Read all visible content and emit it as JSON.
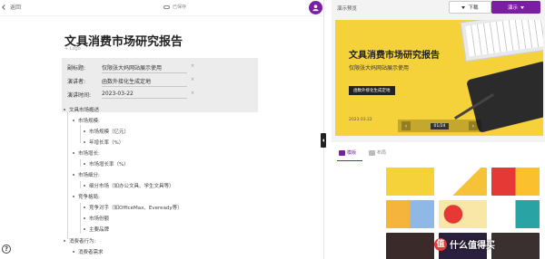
{
  "topbar": {
    "back_label": "返回",
    "saved_label": "已保存"
  },
  "doc": {
    "title": "文具消费市场研究报告",
    "logo_placeholder": "+ Logo",
    "meta": [
      {
        "key": "副标题:",
        "value": "仅限张大妈网站展示使用"
      },
      {
        "key": "演讲者:",
        "value": "函数外接化生成定地"
      },
      {
        "key": "演讲时间:",
        "value": "2023-03-22"
      }
    ],
    "outline": [
      {
        "level": 0,
        "text": "文具市场概述"
      },
      {
        "level": 1,
        "text": "市场规模:"
      },
      {
        "level": 2,
        "text": "市场规模（亿元）"
      },
      {
        "level": 2,
        "text": "年增长率（%）"
      },
      {
        "level": 1,
        "text": "市场增长:"
      },
      {
        "level": 2,
        "text": "市场增长率（%）"
      },
      {
        "level": 1,
        "text": "市场细分:"
      },
      {
        "level": 2,
        "text": "细分市场（如办公文具、学生文具等）"
      },
      {
        "level": 1,
        "text": "竞争格局:"
      },
      {
        "level": 2,
        "text": "竞争对手（如OfficeMax、Eveready等）"
      },
      {
        "level": 2,
        "text": "市场份额"
      },
      {
        "level": 2,
        "text": "主要品牌"
      },
      {
        "level": 0,
        "text": "消费者行为:"
      },
      {
        "level": 1,
        "text": "消费者需求"
      }
    ]
  },
  "preview": {
    "title": "演示预览",
    "download_label": "下载",
    "play_label": "演示",
    "slide": {
      "title": "文具消费市场研究报告",
      "subtitle": "仅限张大妈网站展示使用",
      "tag": "函数外接化生成定地",
      "date": "2023.03.22",
      "counter": "01/24"
    },
    "tabs": [
      {
        "label": "模版",
        "active": true
      },
      {
        "label": "布局",
        "active": false
      }
    ]
  },
  "watermark": {
    "badge": "值",
    "text": "什么值得买"
  },
  "colors": {
    "accent": "#7b1fa2",
    "slide_bg": "#f6d23a"
  }
}
